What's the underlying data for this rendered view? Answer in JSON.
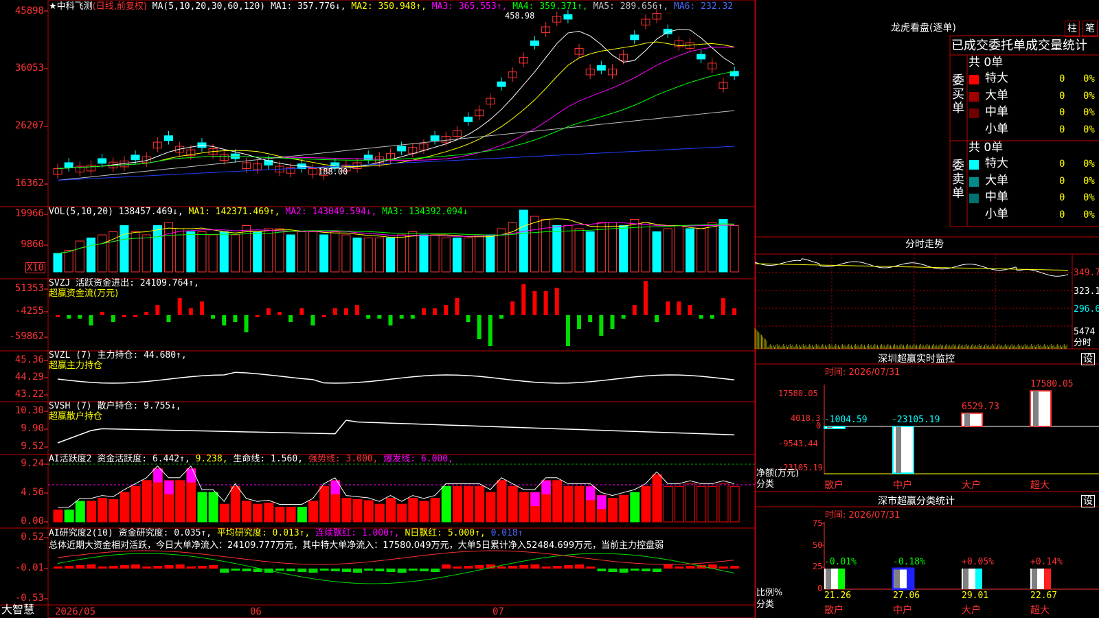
{
  "main": {
    "title": "★中科飞测",
    "mode": "(日线,前复权)",
    "ma": {
      "label": "MA(5,10,20,30,60,120)",
      "ma1": "MA1: 357.776↓,",
      "ma2": "MA2: 350.948↑,",
      "ma3": "MA3: 365.553↑,",
      "ma4": "MA4: 359.371↑,",
      "ma5": "MA5: 289.656↑,",
      "ma6": "MA6: 232.32"
    },
    "y_labels": [
      "45898",
      "36053",
      "26207",
      "16362"
    ],
    "high_marker": "458.98",
    "low_marker": "188.00"
  },
  "vol": {
    "label": "VOL(5,10,20)",
    "value": "138457.469↓,",
    "ma1": "MA1: 142371.469↑,",
    "ma2": "MA2: 143049.594↓,",
    "ma3": "MA3: 134392.094↓",
    "y_labels": [
      "19966",
      "9860"
    ],
    "unit": "X10"
  },
  "svzj": {
    "label": "SVZJ  活跃资金进出: 24109.764↑,",
    "sub": "超赢资金流(万元)",
    "y_labels": [
      "51353",
      "-4255",
      "-59862"
    ]
  },
  "svzl": {
    "label": "SVZL (7) 主力持仓: 44.680↑,",
    "sub": "超赢主力持仓",
    "y_labels": [
      "45.36",
      "44.29",
      "43.22"
    ]
  },
  "svsh": {
    "label": "SVSH (7) 散户持仓: 9.755↓,",
    "sub": "超赢散户持仓",
    "y_labels": [
      "10.30",
      "9.90",
      "9.52"
    ]
  },
  "ai1": {
    "label": "AI活跃度2 资金活跃度: 6.442↑,",
    "v2": "9.238,",
    "v3": "生命线: 1.560,",
    "v4": "强势线: 3.000,",
    "v5": "爆发线: 6.000,",
    "y_labels": [
      "9.24",
      "4.56",
      "0.00"
    ]
  },
  "ai2": {
    "label": "AI研究度2(10) 资金研究度: 0.035↑,",
    "v2": "平均研究度: 0.013↑,",
    "v3": "连续飘红: 1.000↑,",
    "v4": "N日飘红: 5.000↑,",
    "v5": "0.018↑",
    "summary": "总体近期大资金相对活跃，今日大单净流入：24109.777万元，其中特大单净流入：17580.049万元，大单5日累计净入52484.699万元，当前主力控盘弱",
    "y_labels": [
      "0.52",
      "-0.01",
      "-0.53"
    ]
  },
  "bottom": {
    "logo": "大智慧",
    "dates": [
      "2026/05",
      "06",
      "07"
    ]
  },
  "right": {
    "dragon": {
      "title": "龙虎看盘(逐单)",
      "btn1": "柱",
      "btn2": "笔",
      "header": "已成交委托单成交量统计",
      "buy": {
        "label": "委买单",
        "total": "共 0单",
        "rows": [
          {
            "name": "特大",
            "v": "0",
            "p": "0%",
            "color": "#ff0000"
          },
          {
            "name": "大单",
            "v": "0",
            "p": "0%",
            "color": "#a00000"
          },
          {
            "name": "中单",
            "v": "0",
            "p": "0%",
            "color": "#700000"
          },
          {
            "name": "小单",
            "v": "0",
            "p": "0%",
            "color": "#000000"
          }
        ]
      },
      "sell": {
        "label": "委卖单",
        "total": "共 0单",
        "rows": [
          {
            "name": "特大",
            "v": "0",
            "p": "0%",
            "color": "#00ffff"
          },
          {
            "name": "大单",
            "v": "0",
            "p": "0%",
            "color": "#008a8a"
          },
          {
            "name": "中单",
            "v": "0",
            "p": "0%",
            "color": "#007070"
          },
          {
            "name": "小单",
            "v": "0",
            "p": "0%",
            "color": "#000000"
          }
        ]
      }
    },
    "fenshi": {
      "title": "分时走势",
      "y_labels": [
        "349.7",
        "323.1",
        "296.6",
        "5474"
      ],
      "unit": "分时"
    },
    "monitor": {
      "title": "深圳超赢实时监控",
      "btn": "设",
      "time": "时间: 2026/07/31",
      "y_labels": [
        "17580.05",
        "4018.3",
        "0",
        "-9543.44",
        "-23105.19"
      ],
      "ylabel": "净额(万元)",
      "xlabel": "分类",
      "categories": [
        "散户",
        "中户",
        "大户",
        "超大"
      ],
      "values": [
        -1004.59,
        -23105.19,
        6529.73,
        17580.05
      ],
      "value_labels": [
        "-1004.59",
        "-23105.19",
        "6529.73",
        "17580.05"
      ]
    },
    "stats": {
      "title": "深市超赢分类统计",
      "btn": "设",
      "time": "时间: 2026/07/31",
      "y_labels": [
        "75",
        "50",
        "25",
        "0"
      ],
      "ylabel": "比例%",
      "xlabel": "分类",
      "categories": [
        "散户",
        "中户",
        "大户",
        "超大"
      ],
      "values": [
        21.26,
        27.06,
        29.01,
        22.67
      ],
      "changes": [
        "-0.01%",
        "-0.18%",
        "+0.05%",
        "+0.14%"
      ]
    }
  },
  "colors": {
    "up": "#ff3232",
    "down": "#00ffff",
    "grid": "#c00000"
  }
}
